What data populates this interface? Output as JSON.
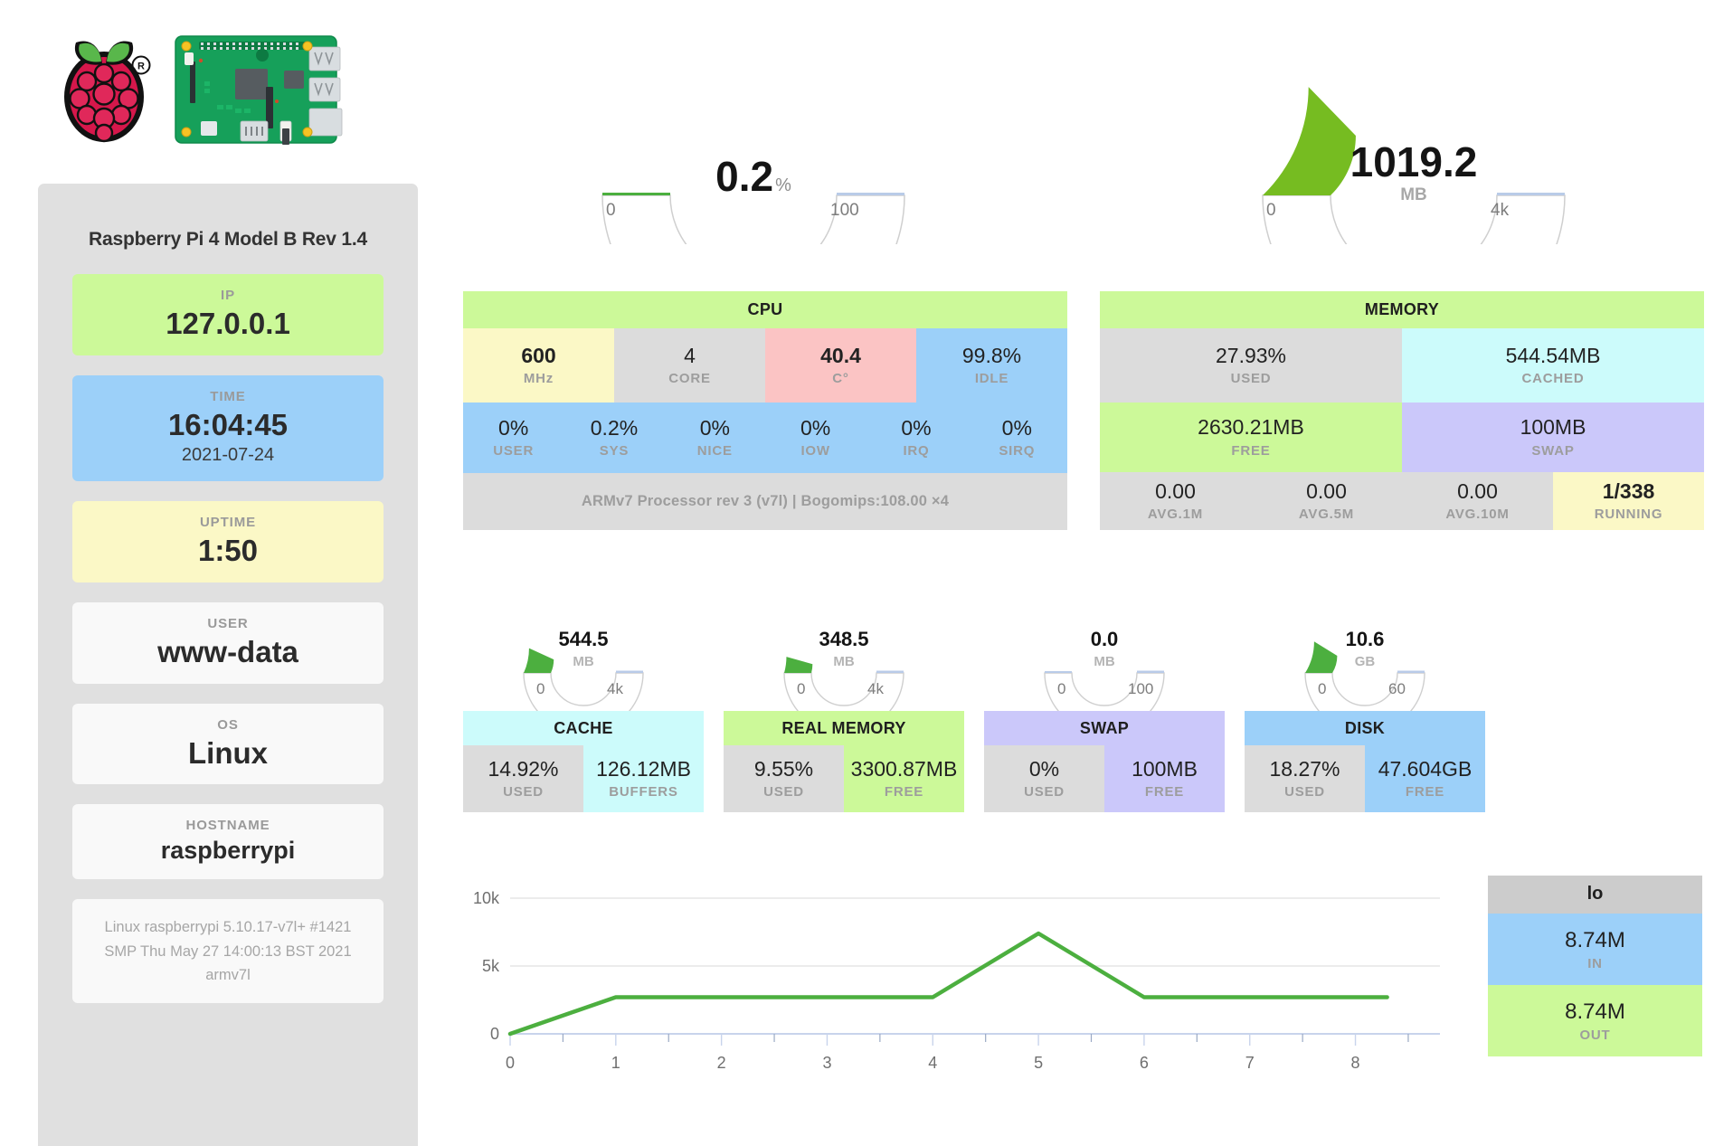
{
  "sidebar": {
    "logo_alt": "raspberry-pi-logo",
    "board_alt": "raspberry-pi-board",
    "title": "Raspberry Pi 4 Model B Rev 1.4",
    "cards": [
      {
        "label": "IP",
        "value": "127.0.0.1",
        "sub": "",
        "color": "sc-green"
      },
      {
        "label": "TIME",
        "value": "16:04:45",
        "sub": "2021-07-24",
        "color": "sc-blue"
      },
      {
        "label": "UPTIME",
        "value": "1:50",
        "sub": "",
        "color": "sc-yellow"
      },
      {
        "label": "USER",
        "value": "www-data",
        "sub": "",
        "color": "sc-white"
      },
      {
        "label": "OS",
        "value": "Linux",
        "sub": "",
        "color": "sc-white"
      },
      {
        "label": "HOSTNAME",
        "value": "raspberrypi",
        "sub": "",
        "color": "sc-white"
      }
    ],
    "kernel": "Linux raspberrypi 5.10.17-v7l+ #1421 SMP Thu May 27 14:00:13 BST 2021 armv7l"
  },
  "cpu_gauge": {
    "value": "0.2",
    "unit": "%",
    "min_label": "0",
    "max_label": "100",
    "min": 0,
    "max": 100,
    "current": 0.2
  },
  "memory_gauge": {
    "value": "1019.2",
    "unit": "MB",
    "min_label": "0",
    "max_label": "4k",
    "min": 0,
    "max": 4000,
    "current": 1019.2
  },
  "cpu_panel": {
    "title": "CPU",
    "row1": [
      {
        "value": "600",
        "label": "MHz",
        "color": "bg-ylw",
        "bold": true
      },
      {
        "value": "4",
        "label": "CORE",
        "color": "bg-gry",
        "bold": false
      },
      {
        "value": "40.4",
        "label": "C°",
        "color": "bg-pnk",
        "bold": true
      },
      {
        "value": "99.8%",
        "label": "IDLE",
        "color": "bg-blu",
        "bold": false
      }
    ],
    "row2": [
      {
        "value": "0%",
        "label": "USER"
      },
      {
        "value": "0.2%",
        "label": "SYS"
      },
      {
        "value": "0%",
        "label": "NICE"
      },
      {
        "value": "0%",
        "label": "IOW"
      },
      {
        "value": "0%",
        "label": "IRQ"
      },
      {
        "value": "0%",
        "label": "SIRQ"
      }
    ],
    "note": "ARMv7 Processor rev 3 (v7l) | Bogomips:108.00 ×4"
  },
  "memory_panel": {
    "title": "MEMORY",
    "row1": [
      {
        "value": "27.93%",
        "label": "USED",
        "color": "bg-gry"
      },
      {
        "value": "544.54MB",
        "label": "CACHED",
        "color": "bg-cyn"
      }
    ],
    "row2": [
      {
        "value": "2630.21MB",
        "label": "FREE",
        "color": "bg-grn"
      },
      {
        "value": "100MB",
        "label": "SWAP",
        "color": "bg-pur"
      }
    ],
    "row3": [
      {
        "value": "0.00",
        "label": "AVG.1M",
        "color": "bg-gry",
        "bold": false
      },
      {
        "value": "0.00",
        "label": "AVG.5M",
        "color": "bg-gry",
        "bold": false
      },
      {
        "value": "0.00",
        "label": "AVG.10M",
        "color": "bg-gry",
        "bold": false
      },
      {
        "value": "1/338",
        "label": "RUNNING",
        "color": "bg-ylw",
        "bold": true
      }
    ]
  },
  "small_panels": [
    {
      "title": "CACHE",
      "head_color": "bg-cyn",
      "gauge": {
        "value": "544.5",
        "unit": "MB",
        "min_label": "0",
        "max_label": "4k",
        "min": 0,
        "max": 4000,
        "current": 544.5
      },
      "cells": [
        {
          "value": "14.92%",
          "label": "USED",
          "color": "bg-gry"
        },
        {
          "value": "126.12MB",
          "label": "BUFFERS",
          "color": "bg-cyn"
        }
      ]
    },
    {
      "title": "REAL MEMORY",
      "head_color": "bg-grn",
      "gauge": {
        "value": "348.5",
        "unit": "MB",
        "min_label": "0",
        "max_label": "4k",
        "min": 0,
        "max": 4000,
        "current": 348.5
      },
      "cells": [
        {
          "value": "9.55%",
          "label": "USED",
          "color": "bg-gry"
        },
        {
          "value": "3300.87MB",
          "label": "FREE",
          "color": "bg-grn"
        }
      ]
    },
    {
      "title": "SWAP",
      "head_color": "bg-pur",
      "gauge": {
        "value": "0.0",
        "unit": "MB",
        "min_label": "0",
        "max_label": "100",
        "min": 0,
        "max": 100,
        "current": 0.0
      },
      "cells": [
        {
          "value": "0%",
          "label": "USED",
          "color": "bg-gry"
        },
        {
          "value": "100MB",
          "label": "FREE",
          "color": "bg-pur"
        }
      ]
    },
    {
      "title": "DISK",
      "head_color": "bg-blu",
      "gauge": {
        "value": "10.6",
        "unit": "GB",
        "min_label": "0",
        "max_label": "60",
        "min": 0,
        "max": 60,
        "current": 10.6
      },
      "cells": [
        {
          "value": "18.27%",
          "label": "USED",
          "color": "bg-gry"
        },
        {
          "value": "47.604GB",
          "label": "FREE",
          "color": "bg-blu"
        }
      ]
    }
  ],
  "net_panel": {
    "title": "lo",
    "in": {
      "value": "8.74M",
      "label": "IN"
    },
    "out": {
      "value": "8.74M",
      "label": "OUT"
    }
  },
  "chart_data": {
    "type": "line",
    "title": "",
    "xlabel": "",
    "ylabel": "",
    "x": [
      0,
      1,
      2,
      3,
      4,
      5,
      6,
      7,
      8,
      8.3
    ],
    "values": [
      0,
      2700,
      2700,
      2700,
      2700,
      7400,
      2700,
      2700,
      2700,
      2700
    ],
    "series": [
      {
        "name": "traffic",
        "values": [
          0,
          2700,
          2700,
          2700,
          2700,
          7400,
          2700,
          2700,
          2700,
          2700
        ],
        "color": "#4caf3f"
      }
    ],
    "xticks": [
      "0",
      "1",
      "2",
      "3",
      "4",
      "5",
      "6",
      "7",
      "8"
    ],
    "yticks": [
      "0",
      "5k",
      "10k"
    ],
    "ylim": [
      0,
      10000
    ],
    "xlim": [
      0,
      8.8
    ],
    "grid": true,
    "legend": "none"
  },
  "colors": {
    "green": "#ccf999",
    "blue": "#9cd0f9",
    "yellow": "#fbf8c6",
    "pink": "#fbc4c4",
    "cyan": "#ccfbfb",
    "purple": "#cbc8fa",
    "gray": "#dcdcdc",
    "gauge_fill": "#76bc21",
    "gauge_fill_small": "#4caf3f",
    "line": "#4caf3f"
  }
}
